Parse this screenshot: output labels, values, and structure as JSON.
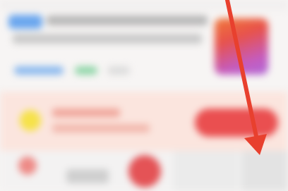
{
  "screen": {
    "state": "blurred",
    "colors": {
      "background": "#f7f5f4",
      "title_tag": "#6aa6ee",
      "banner": "#fbe5de",
      "coin": "#f6e24a",
      "action_pill": "#ea4f50",
      "circle": "#e45356",
      "pointer": "#e8402e"
    }
  },
  "pointer": {
    "icon": "red-arrow-icon",
    "direction": "down"
  }
}
